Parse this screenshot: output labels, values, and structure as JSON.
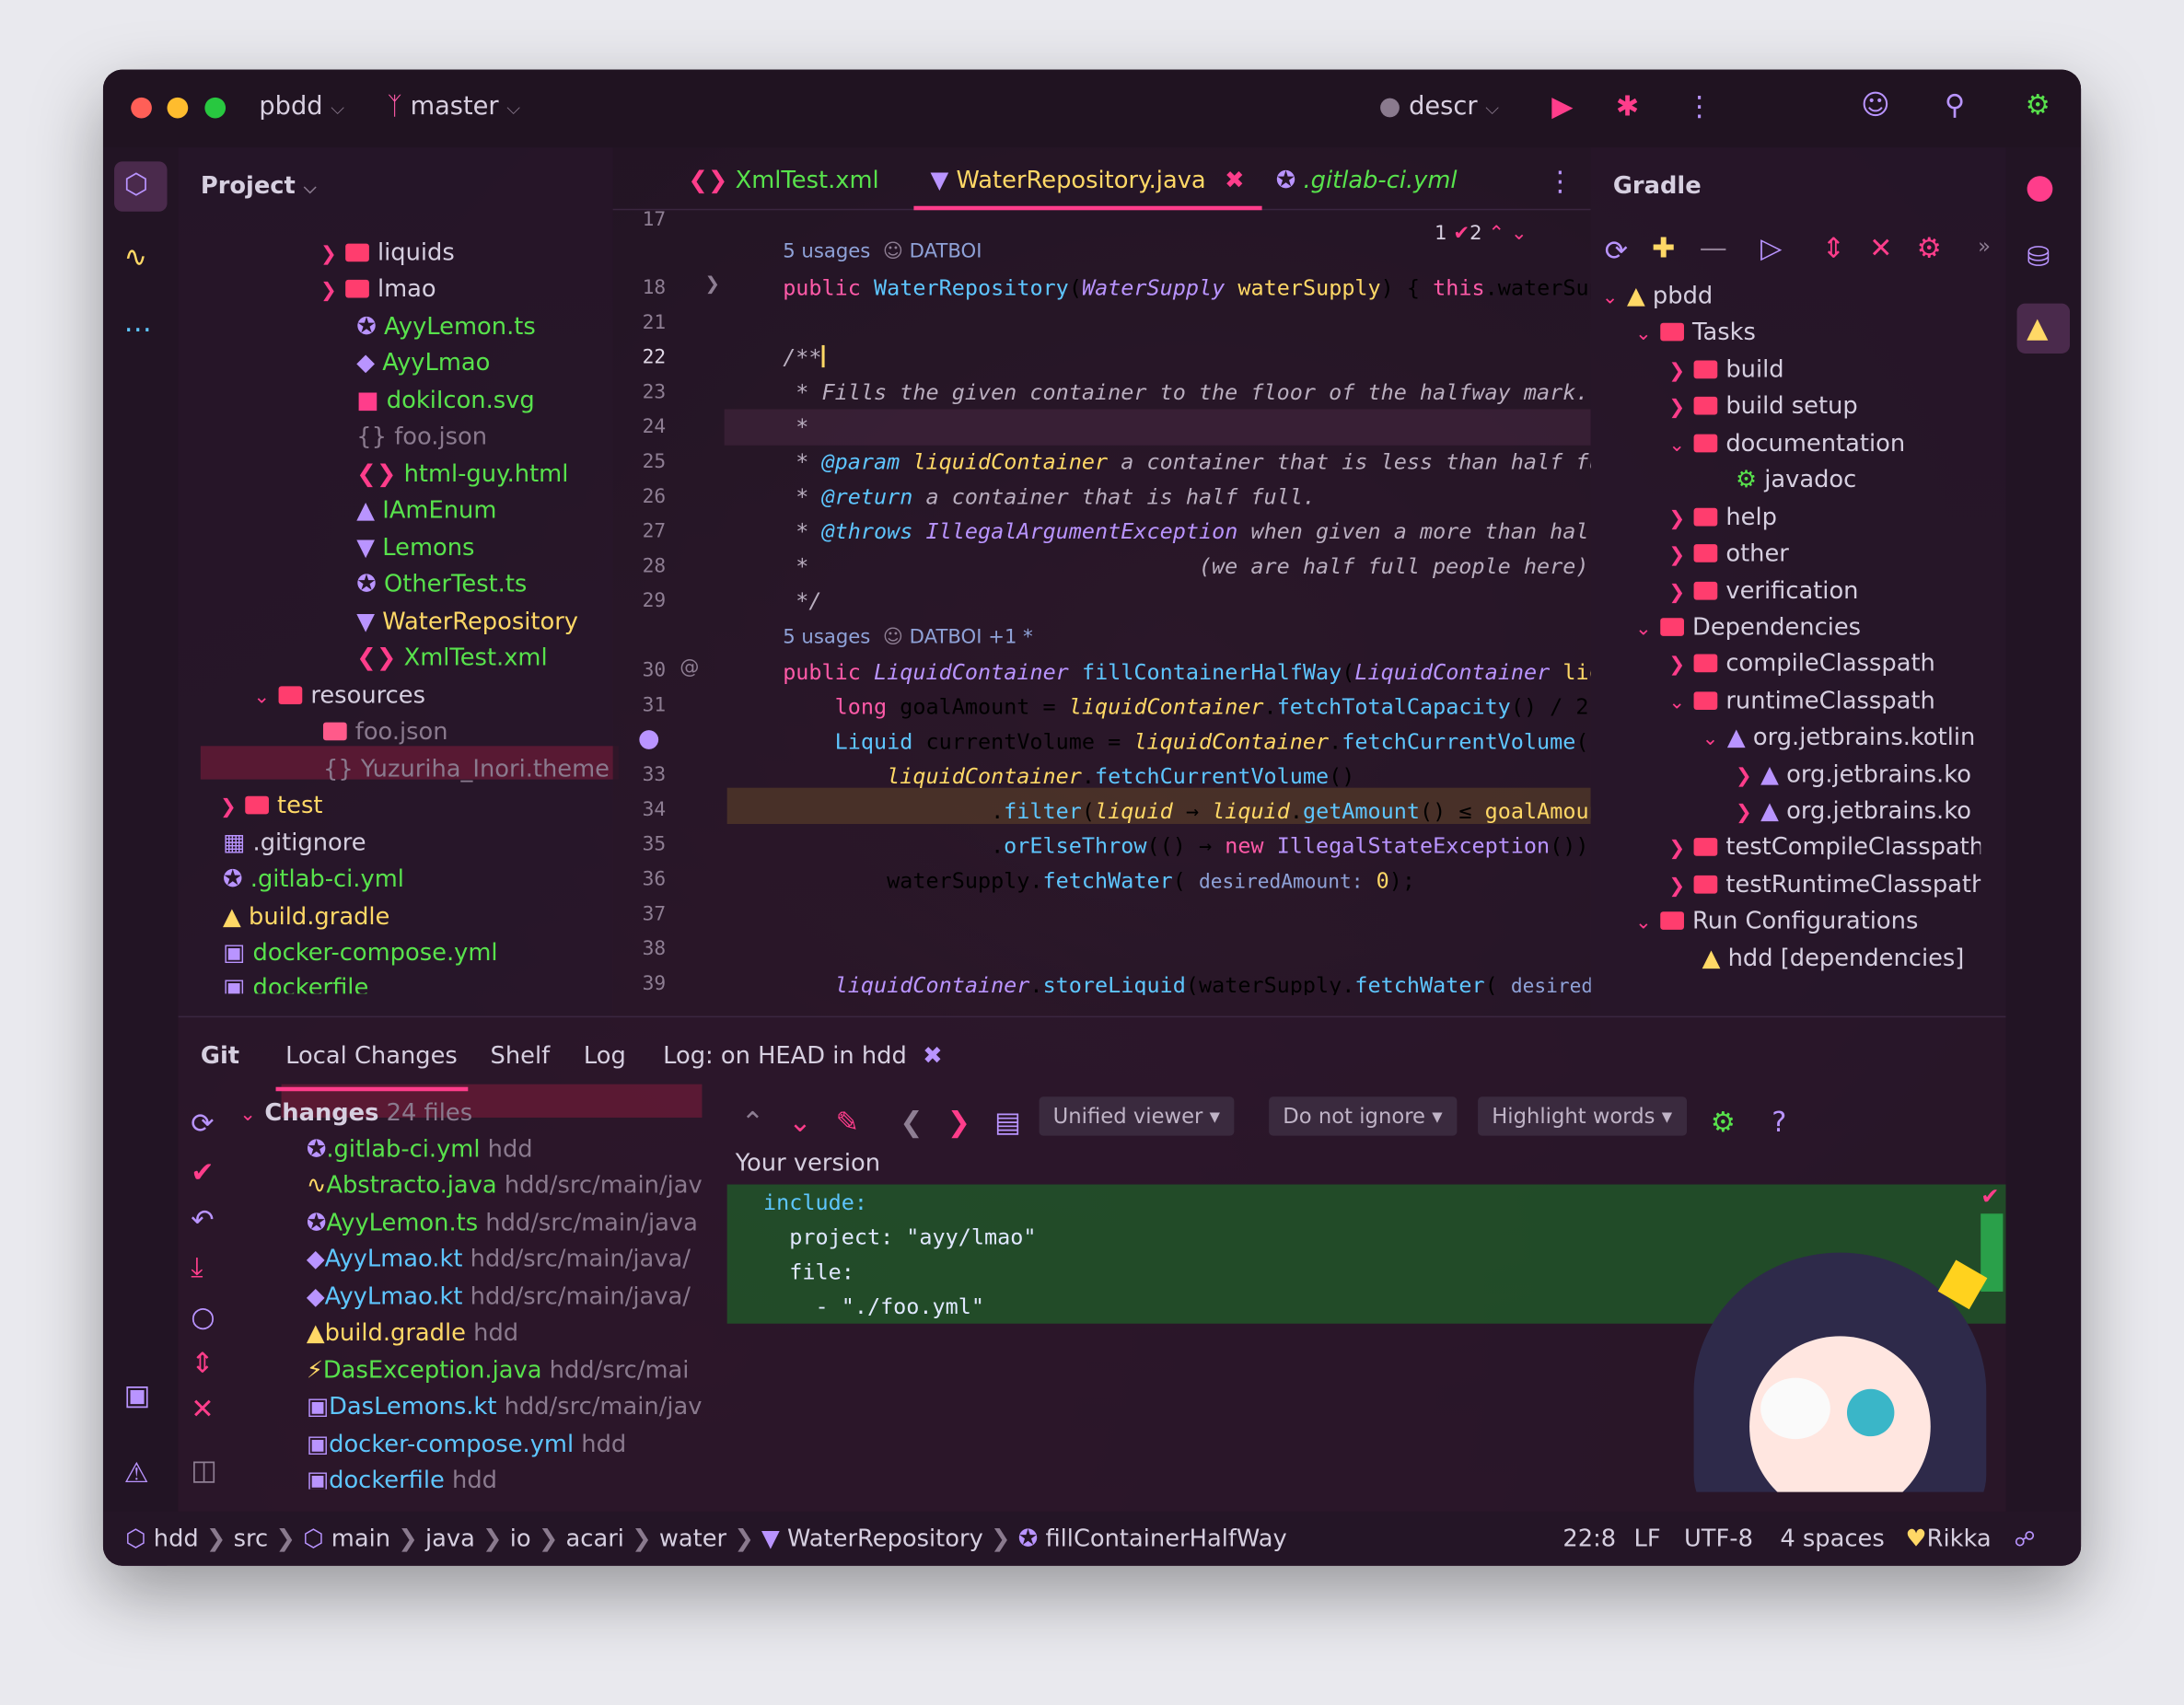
{
  "titlebar": {
    "project": "pbdd",
    "branch": "master",
    "run_config": "descr"
  },
  "project_panel": {
    "title": "Project",
    "items": [
      {
        "label": "liquids",
        "type": "folder"
      },
      {
        "label": "lmao",
        "type": "folder"
      },
      {
        "label": "AyyLemon.ts",
        "type": "file"
      },
      {
        "label": "AyyLmao",
        "type": "file"
      },
      {
        "label": "dokiIcon.svg",
        "type": "file"
      },
      {
        "label": "foo.json",
        "type": "file-ignored"
      },
      {
        "label": "html-guy.html",
        "type": "file"
      },
      {
        "label": "IAmEnum",
        "type": "file"
      },
      {
        "label": "Lemons",
        "type": "file"
      },
      {
        "label": "OtherTest.ts",
        "type": "file"
      },
      {
        "label": "WaterRepository",
        "type": "file-selected"
      },
      {
        "label": "XmlTest.xml",
        "type": "file"
      },
      {
        "label": "resources",
        "type": "folder"
      },
      {
        "label": "foo.json",
        "type": "file-ignored"
      },
      {
        "label": "Yuzuriha_Inori.theme",
        "type": "file-ignored"
      },
      {
        "label": "test",
        "type": "folder"
      },
      {
        "label": ".gitignore",
        "type": "file"
      },
      {
        "label": ".gitlab-ci.yml",
        "type": "file"
      },
      {
        "label": "build.gradle",
        "type": "file"
      },
      {
        "label": "docker-compose.yml",
        "type": "file"
      },
      {
        "label": "dockerfile",
        "type": "file"
      }
    ]
  },
  "editor": {
    "tabs": [
      {
        "label": "XmlTest.xml"
      },
      {
        "label": "WaterRepository.java"
      },
      {
        "label": ".gitlab-ci.yml"
      }
    ],
    "inspection": {
      "warnings": "1",
      "checks": "2"
    },
    "usages_1": "5 usages",
    "author_1": "DATBOI",
    "usages_2": "5 usages",
    "author_2": "DATBOI +1 *",
    "hint_1": "desiredAmount:",
    "hint_2": "desiredA",
    "line_numbers": [
      "17",
      "18",
      "21",
      "22",
      "23",
      "24",
      "25",
      "26",
      "27",
      "28",
      "29",
      "30",
      "31",
      "32",
      "33",
      "34",
      "35",
      "36",
      "37",
      "38",
      "39"
    ]
  },
  "gradle": {
    "title": "Gradle",
    "items": [
      {
        "label": "pbdd"
      },
      {
        "label": "Tasks"
      },
      {
        "label": "build"
      },
      {
        "label": "build setup"
      },
      {
        "label": "documentation"
      },
      {
        "label": "javadoc"
      },
      {
        "label": "help"
      },
      {
        "label": "other"
      },
      {
        "label": "verification"
      },
      {
        "label": "Dependencies"
      },
      {
        "label": "compileClasspath"
      },
      {
        "label": "runtimeClasspath"
      },
      {
        "label": "org.jetbrains.kotlin"
      },
      {
        "label": "org.jetbrains.ko"
      },
      {
        "label": "org.jetbrains.ko"
      },
      {
        "label": "testCompileClasspath"
      },
      {
        "label": "testRuntimeClasspath"
      },
      {
        "label": "Run Configurations"
      },
      {
        "label": "hdd [dependencies]"
      }
    ]
  },
  "bottom": {
    "tabs": [
      "Git",
      "Local Changes",
      "Shelf",
      "Log",
      "Log: on HEAD in hdd"
    ],
    "changes_label": "Changes",
    "changes_count": "24 files",
    "files": [
      {
        "name": ".gitlab-ci.yml",
        "path": "hdd"
      },
      {
        "name": "Abstracto.java",
        "path": "hdd/src/main/jav"
      },
      {
        "name": "AyyLemon.ts",
        "path": "hdd/src/main/java"
      },
      {
        "name": "AyyLmao.kt",
        "path": "hdd/src/main/java/"
      },
      {
        "name": "AyyLmao.kt",
        "path": "hdd/src/main/java/"
      },
      {
        "name": "build.gradle",
        "path": "hdd"
      },
      {
        "name": "DasException.java",
        "path": "hdd/src/mai"
      },
      {
        "name": "DasLemons.kt",
        "path": "hdd/src/main/jav"
      },
      {
        "name": "docker-compose.yml",
        "path": "hdd"
      },
      {
        "name": "dockerfile",
        "path": "hdd"
      }
    ],
    "diff_toolbar": {
      "viewer": "Unified viewer",
      "ignore": "Do not ignore",
      "highlight": "Highlight words"
    },
    "diff_title": "Your version",
    "diff_lines": [
      "include:",
      "  project: \"ayy/lmao\"",
      "  file:",
      "    - \"./foo.yml\""
    ]
  },
  "statusbar": {
    "breadcrumbs": [
      "hdd",
      "src",
      "main",
      "java",
      "io",
      "acari",
      "water",
      "WaterRepository",
      "fillContainerHalfWay"
    ],
    "position": "22:8",
    "line_sep": "LF",
    "encoding": "UTF-8",
    "indent": "4 spaces",
    "theme": "Rikka"
  },
  "colors": {
    "accent": "#ff3d8b",
    "modified_green": "#58e24c",
    "background": "#2a1a2c"
  }
}
